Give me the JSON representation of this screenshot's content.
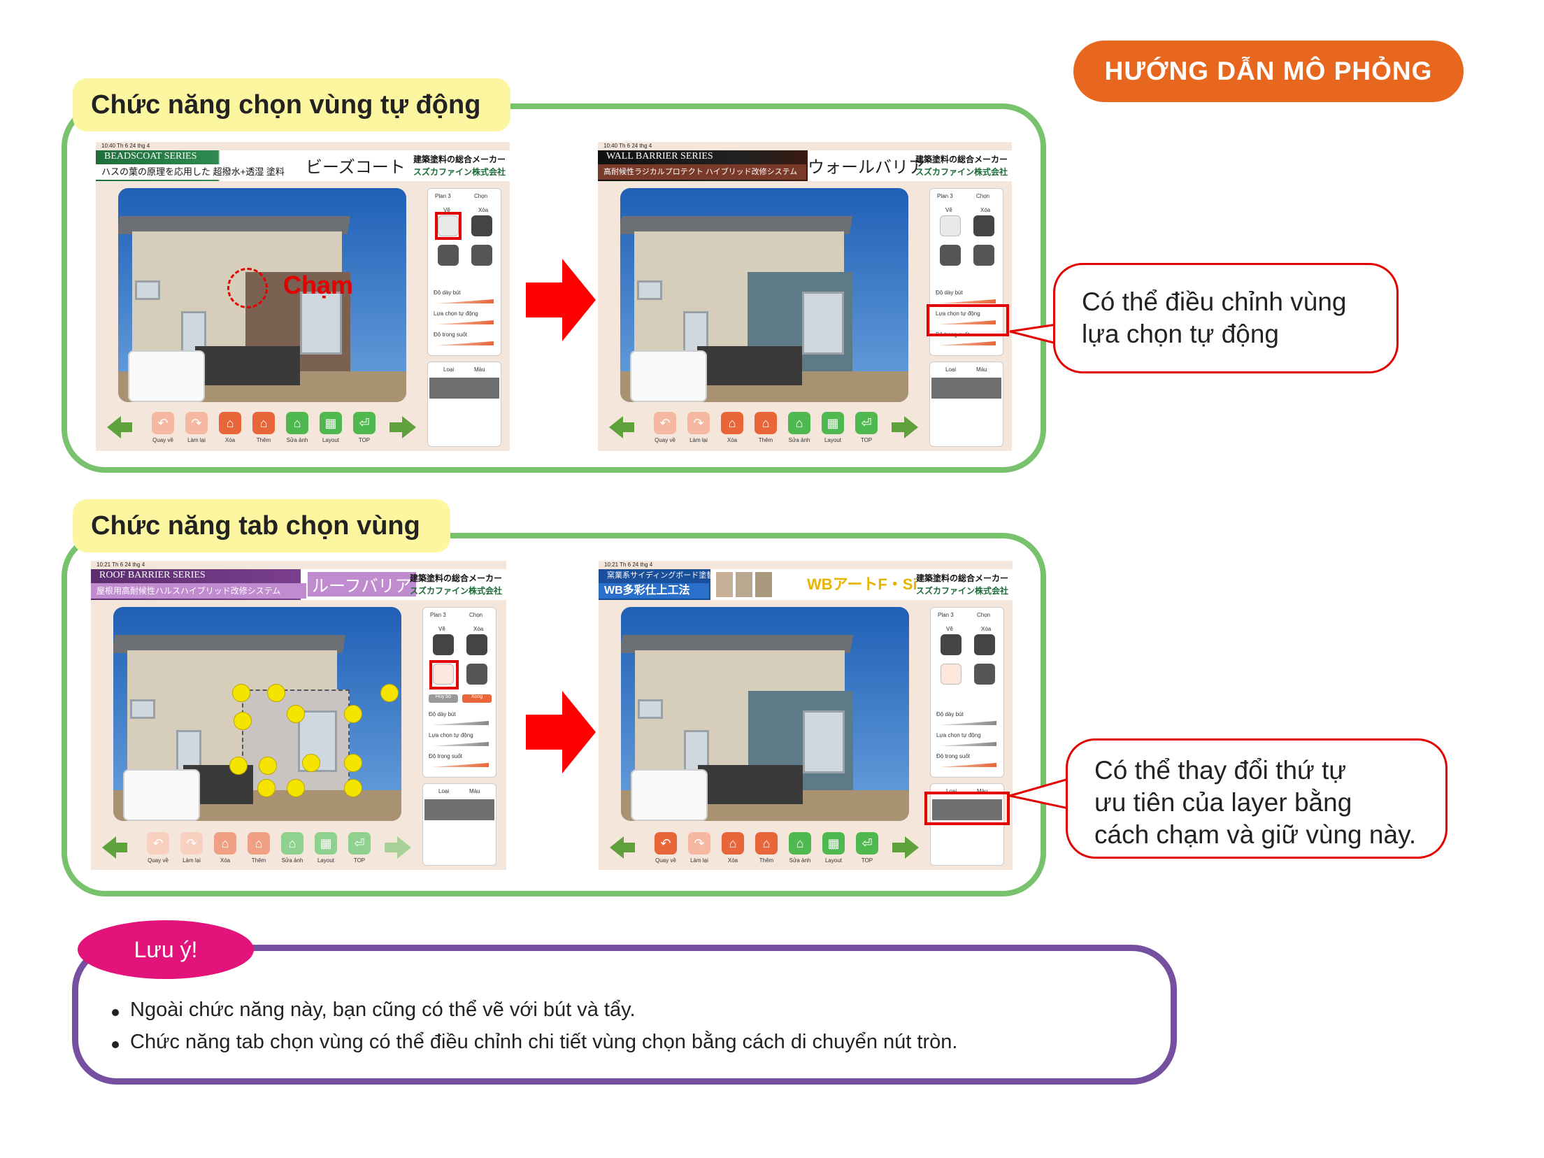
{
  "header": {
    "guide_label": "HƯỚNG DẪN MÔ PHỎNG"
  },
  "section1": {
    "title": "Chức năng chọn vùng tự động",
    "callout": [
      "Có thể điều chỉnh vùng",
      "lựa chọn tự động"
    ],
    "touch_label": "Chạm",
    "left_shot": {
      "status": "10:40  Th 6 24 thg 4",
      "series": "BEADSCOAT SERIES",
      "tagline": "ハスの葉の原理を応用した 超撥水+透湿 塗料",
      "product": "ビーズコート",
      "maker1": "建築塗料の総合メーカー",
      "maker2": "スズカファイン株式会社"
    },
    "right_shot": {
      "status": "10:40  Th 6 24 thg 4",
      "series": "WALL BARRIER SERIES",
      "tagline": "高耐候性ラジカルプロテクト ハイブリッド改修システム",
      "product": "ウォールバリア",
      "maker1": "建築塗料の総合メーカー",
      "maker2": "スズカファイン株式会社"
    }
  },
  "section2": {
    "title": "Chức năng tab chọn vùng",
    "callout": [
      "Có thể thay đổi thứ tự",
      "ưu tiên của layer bằng",
      "cách chạm và giữ vùng này."
    ],
    "left_shot": {
      "status": "10:21  Th 6 24 thg 4",
      "series": "ROOF BARRIER SERIES",
      "tagline": "屋根用高耐候性ハルスハイブリッド改修システム",
      "product": "ルーフバリア",
      "maker1": "建築塗料の総合メーカー",
      "maker2": "スズカファイン株式会社"
    },
    "right_shot": {
      "status": "10:21  Th 6 24 thg 4",
      "series": "窯業系サイディングボード塗替用",
      "tagline": "WB多彩仕上工法",
      "product": "WBアートF・Si",
      "maker1": "建築塗料の総合メーカー",
      "maker2": "スズカファイン株式会社"
    }
  },
  "app_ui": {
    "plan": "Plan 3",
    "chon": "Chọn",
    "ve": "Vẽ",
    "xoa": "Xóa",
    "huy_bo": "Hủy bỏ",
    "xong": "Xong",
    "do_day_but": "Độ dày bút",
    "lua_chon_tu_dong": "Lựa chọn tự động",
    "do_trong_suot": "Độ trong suốt",
    "loai": "Loại",
    "mau": "Màu",
    "toolbar": [
      "Quay về",
      "Làm lại",
      "Xóa",
      "Thêm",
      "Sửa ảnh",
      "Layout",
      "TOP"
    ]
  },
  "note": {
    "title": "Lưu ý!",
    "items": [
      "Ngoài chức năng này, bạn cũng có thể vẽ với bút và tẩy.",
      "Chức năng tab chọn vùng có thể điều chỉnh chi tiết vùng chọn bằng cách di chuyển nút tròn."
    ]
  },
  "colors": {
    "frame_green": "#78c26d",
    "accent_orange": "#e8671f",
    "callout_red": "#e30000",
    "note_purple": "#7650a0",
    "note_pink": "#e2147b",
    "tag_yellow": "#fdf6a0",
    "wall_brown": "#7a6151",
    "wall_blue": "#5e7a86",
    "wall_grey": "#c9c4c2",
    "handle_yellow": "#f5e400"
  }
}
